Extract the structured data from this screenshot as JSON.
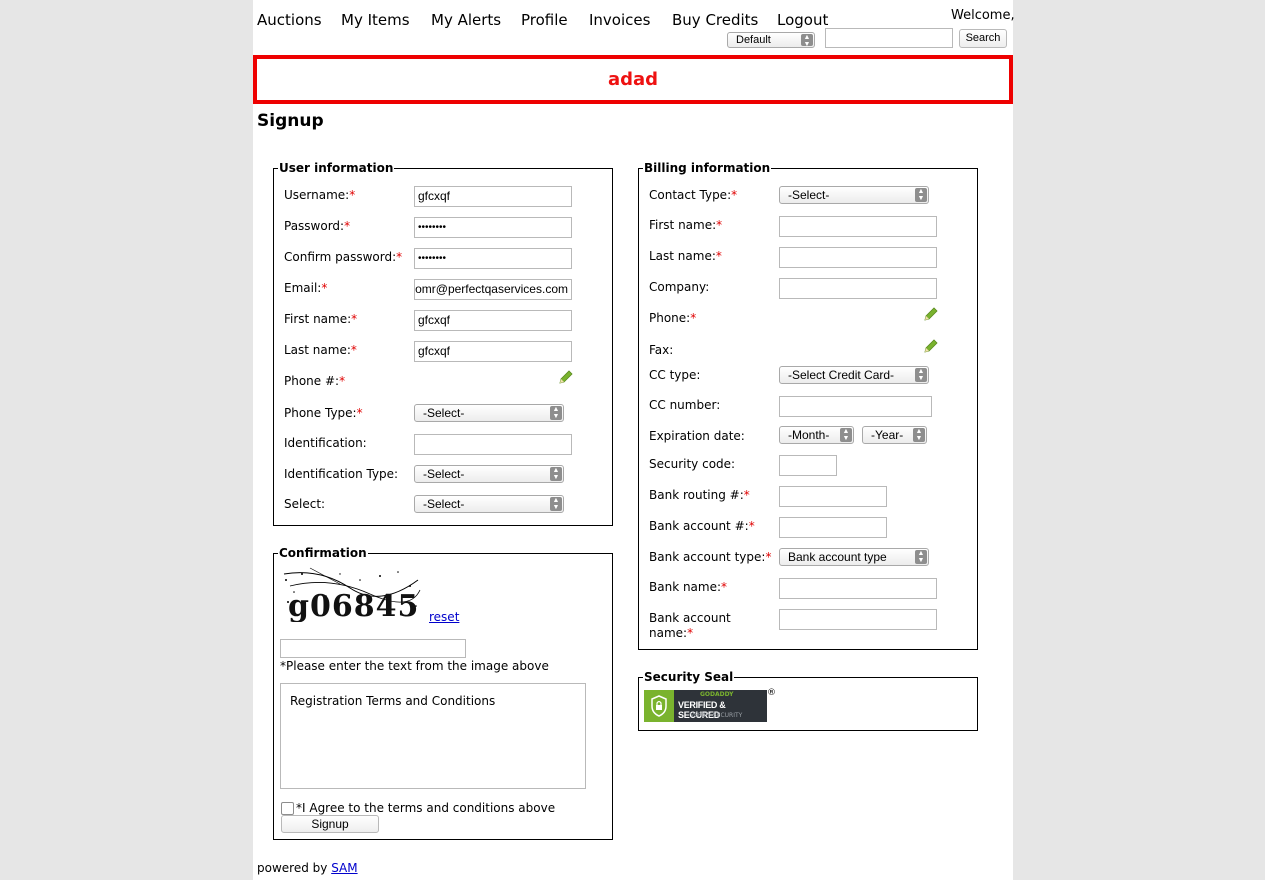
{
  "nav": {
    "items": [
      "Auctions",
      "My Items",
      "My Alerts",
      "Profile",
      "Invoices",
      "Buy Credits",
      "Logout"
    ],
    "welcome": "Welcome,",
    "language_select": "Default",
    "search_value": "",
    "search_button": "Search"
  },
  "banner": {
    "text": "adad",
    "color": "#ee0000"
  },
  "page_title": "Signup",
  "user_info": {
    "legend": "User information",
    "username_label": "Username:",
    "username_value": "gfcxqf",
    "password_label": "Password:",
    "password_value": "••••••••",
    "confirm_label": "Confirm password:",
    "confirm_value": "••••••••",
    "email_label": "Email:",
    "email_value": "omr@perfectqaservices.com",
    "first_name_label": "First name:",
    "first_name_value": "gfcxqf",
    "last_name_label": "Last name:",
    "last_name_value": "gfcxqf",
    "phone_label": "Phone #:",
    "phone_type_label": "Phone Type:",
    "phone_type_value": "-Select-",
    "identification_label": "Identification:",
    "identification_value": "",
    "identification_type_label": "Identification Type:",
    "identification_type_value": "-Select-",
    "select_label": "Select:",
    "select_value": "-Select-"
  },
  "confirmation": {
    "legend": "Confirmation",
    "captcha_text": "g06845",
    "reset_link": "reset",
    "captcha_input": "",
    "captcha_hint": "*Please enter the text from the image above",
    "terms_text": "Registration Terms and Conditions",
    "agree_label": "*I Agree to the terms and conditions above",
    "signup_button": "Signup"
  },
  "billing": {
    "legend": "Billing information",
    "contact_type_label": "Contact Type:",
    "contact_type_value": "-Select-",
    "first_name_label": "First name:",
    "last_name_label": "Last name:",
    "company_label": "Company:",
    "phone_label": "Phone:",
    "fax_label": "Fax:",
    "cc_type_label": "CC type:",
    "cc_type_value": "-Select Credit Card-",
    "cc_number_label": "CC number:",
    "expiration_label": "Expiration date:",
    "month_value": "-Month-",
    "year_value": "-Year-",
    "security_code_label": "Security code:",
    "bank_routing_label": "Bank routing #:",
    "bank_account_label": "Bank account #:",
    "bank_account_type_label": "Bank account type:",
    "bank_account_type_value": "Bank account type",
    "bank_name_label": "Bank name:",
    "bank_account_name_label_1": "Bank account",
    "bank_account_name_label_2": "name:"
  },
  "security_seal": {
    "legend": "Security Seal",
    "seal_top": "GODADDY",
    "seal_main": "VERIFIED & SECURED",
    "seal_sub": "VERIFY SECURITY",
    "registered": "®"
  },
  "footer": {
    "powered_by": "powered by ",
    "link": "SAM"
  },
  "colors": {
    "required": "#e00000",
    "accent_green": "#7ab32e",
    "link": "#0000cc"
  }
}
